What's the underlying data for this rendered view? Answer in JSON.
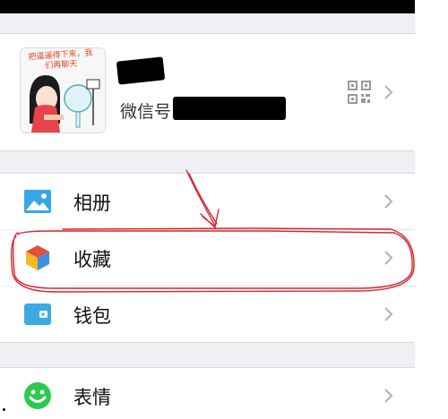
{
  "profile": {
    "avatar_caption": "把逼逼得下来，我们再聊天",
    "wechat_id_label": "微信号"
  },
  "menu": {
    "album": "相册",
    "favorites": "收藏",
    "wallet": "钱包",
    "stickers": "表情"
  },
  "colors": {
    "annotation": "#d9232d",
    "album_icon": "#35a7e6",
    "wallet_icon": "#3ca9e0",
    "stickers_icon": "#2eca4f",
    "background": "#efeff4"
  }
}
